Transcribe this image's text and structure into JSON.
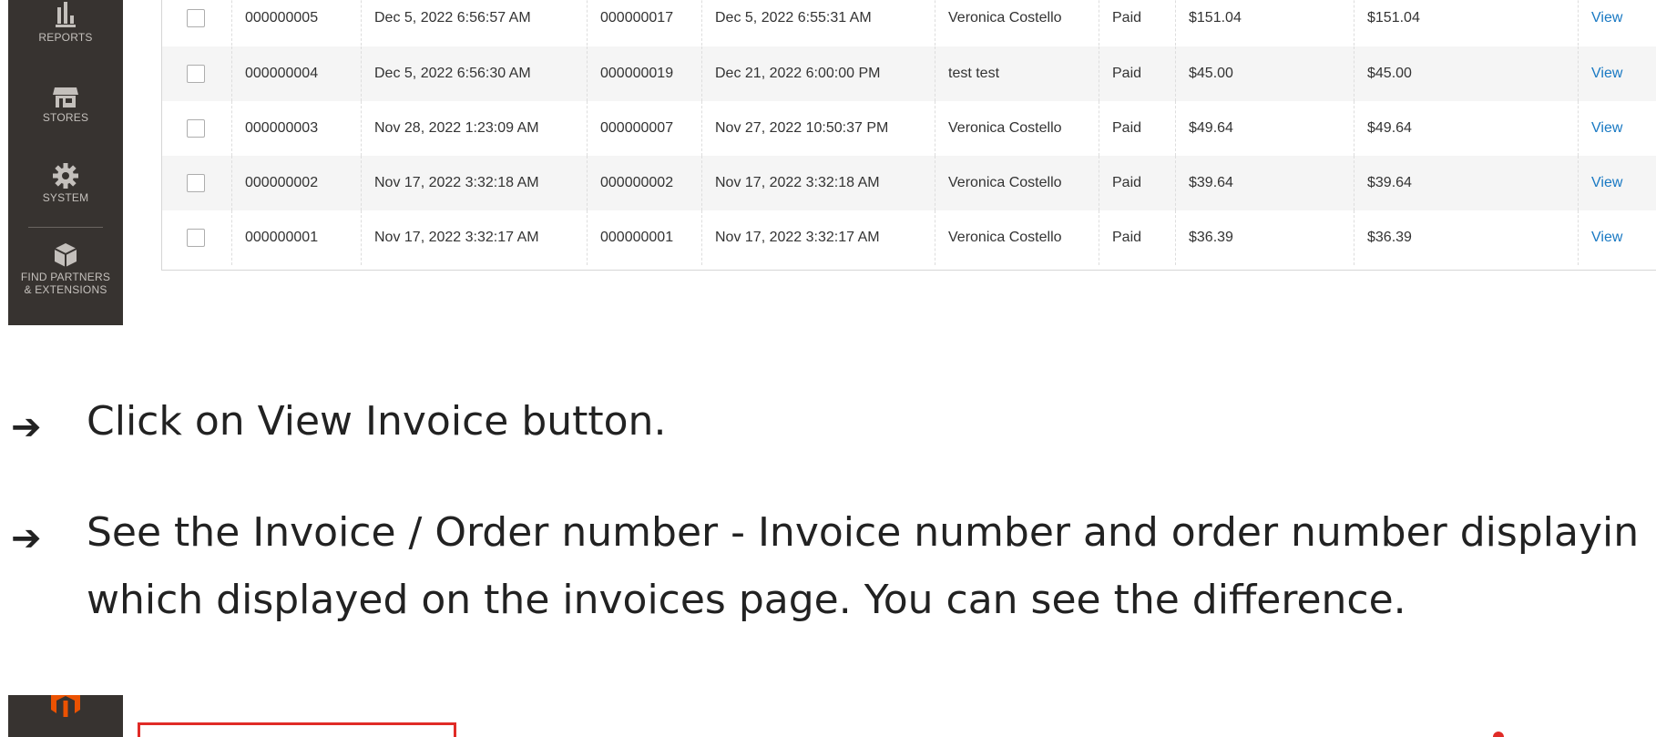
{
  "sidebar": {
    "items": [
      {
        "label": "REPORTS",
        "icon": "bar-chart-icon"
      },
      {
        "label": "STORES",
        "icon": "store-icon"
      },
      {
        "label": "SYSTEM",
        "icon": "gear-icon"
      },
      {
        "label_line1": "FIND PARTNERS",
        "label_line2": "& EXTENSIONS",
        "icon": "box-icon"
      }
    ]
  },
  "grid": {
    "rows": [
      {
        "invoice": "000000005",
        "invoice_date": "Dec 5, 2022 6:56:57 AM",
        "order": "000000017",
        "order_date": "Dec 5, 2022 6:55:31 AM",
        "bill_to": "Veronica Costello",
        "status": "Paid",
        "amount1": "$151.04",
        "amount2": "$151.04",
        "action": "View"
      },
      {
        "invoice": "000000004",
        "invoice_date": "Dec 5, 2022 6:56:30 AM",
        "order": "000000019",
        "order_date": "Dec 21, 2022 6:00:00 PM",
        "bill_to": "test test",
        "status": "Paid",
        "amount1": "$45.00",
        "amount2": "$45.00",
        "action": "View"
      },
      {
        "invoice": "000000003",
        "invoice_date": "Nov 28, 2022 1:23:09 AM",
        "order": "000000007",
        "order_date": "Nov 27, 2022 10:50:37 PM",
        "bill_to": "Veronica Costello",
        "status": "Paid",
        "amount1": "$49.64",
        "amount2": "$49.64",
        "action": "View"
      },
      {
        "invoice": "000000002",
        "invoice_date": "Nov 17, 2022 3:32:18 AM",
        "order": "000000002",
        "order_date": "Nov 17, 2022 3:32:18 AM",
        "bill_to": "Veronica Costello",
        "status": "Paid",
        "amount1": "$39.64",
        "amount2": "$39.64",
        "action": "View"
      },
      {
        "invoice": "000000001",
        "invoice_date": "Nov 17, 2022 3:32:17 AM",
        "order": "000000001",
        "order_date": "Nov 17, 2022 3:32:17 AM",
        "bill_to": "Veronica Costello",
        "status": "Paid",
        "amount1": "$36.39",
        "amount2": "$36.39",
        "action": "View"
      }
    ]
  },
  "steps": {
    "arrow": "➔",
    "step1": "Click on View Invoice button.",
    "step2_line1": "See the Invoice / Order number - Invoice number and order number displayin",
    "step2_line2": "which displayed on the invoices page. You can see the difference."
  },
  "colors": {
    "sidebar_bg": "#373330",
    "link": "#1979c3",
    "highlight": "#e02b27",
    "logo": "#eb5202"
  }
}
